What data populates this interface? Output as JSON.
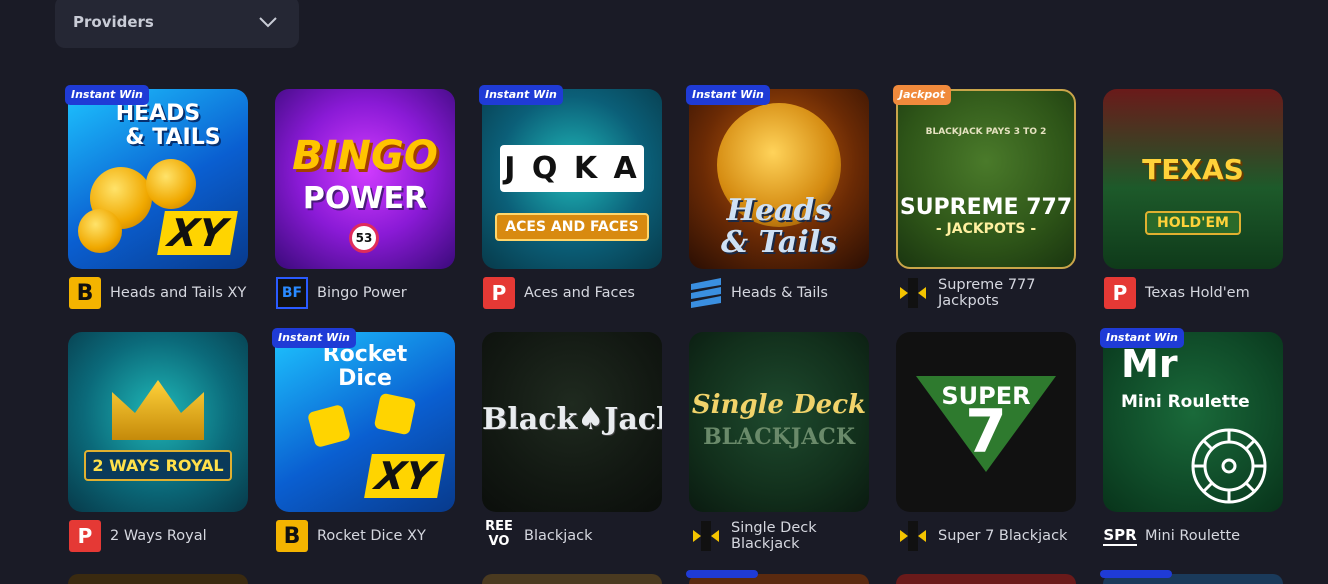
{
  "filter": {
    "label": "Providers"
  },
  "colors": {
    "background": "#1a1b26",
    "panel": "#252734",
    "instant_badge": "#1f3bd6",
    "jackpot_badge": "#f08a3c"
  },
  "games": [
    {
      "name": "Heads and Tails XY",
      "badge": "Instant Win",
      "provider_icon": "b-logo-icon",
      "art": {
        "line1": "HEADS",
        "line2": "& TAILS",
        "tag": "XY"
      }
    },
    {
      "name": "Bingo Power",
      "badge": "",
      "provider_icon": "bf-logo-icon",
      "art": {
        "line1": "BINGO",
        "line2": "POWER",
        "tag": "53"
      }
    },
    {
      "name": "Aces and Faces",
      "badge": "Instant Win",
      "provider_icon": "p-logo-icon",
      "art": {
        "line1": "J Q K A",
        "line2": "ACES AND FACES",
        "tag": ""
      }
    },
    {
      "name": "Heads & Tails",
      "badge": "Instant Win",
      "provider_icon": "wave-logo-icon",
      "art": {
        "line1": "Heads",
        "line2": "& Tails",
        "tag": ""
      }
    },
    {
      "name": "Supreme 777 Jackpots",
      "badge": "Jackpot",
      "provider_icon": "bb-logo-icon",
      "art": {
        "line1": "BLACKJACK PAYS 3 TO 2",
        "line2": "SUPREME 777",
        "tag": "- JACKPOTS -"
      }
    },
    {
      "name": "Texas Hold'em",
      "badge": "",
      "provider_icon": "p-logo-icon",
      "art": {
        "line1": "TEXAS",
        "line2": "HOLD'EM",
        "tag": ""
      }
    },
    {
      "name": "2 Ways Royal",
      "badge": "",
      "provider_icon": "p-logo-icon",
      "art": {
        "line1": "2 WAYS ROYAL",
        "line2": "",
        "tag": ""
      }
    },
    {
      "name": "Rocket Dice XY",
      "badge": "Instant Win",
      "provider_icon": "b-logo-icon",
      "art": {
        "line1": "Rocket",
        "line2": "Dice",
        "tag": "XY"
      }
    },
    {
      "name": "Blackjack",
      "badge": "",
      "provider_icon": "reevo-logo-icon",
      "art": {
        "line1": "Black♠Jack",
        "line2": "",
        "tag": ""
      }
    },
    {
      "name": "Single Deck Blackjack",
      "badge": "",
      "provider_icon": "bb-logo-icon",
      "art": {
        "line1": "Single Deck",
        "line2": "BLACKJACK",
        "tag": ""
      }
    },
    {
      "name": "Super 7 Blackjack",
      "badge": "",
      "provider_icon": "bb-logo-icon",
      "art": {
        "line1": "SUPER",
        "line2": "7",
        "tag": ""
      }
    },
    {
      "name": "Mini Roulette",
      "badge": "Instant Win",
      "provider_icon": "spr-logo-icon",
      "art": {
        "line1": "Mr",
        "line2": "Mini Roulette",
        "tag": ""
      }
    }
  ],
  "provider_logos": {
    "b": "B",
    "p": "P",
    "reevo_top": "REE",
    "reevo_bottom": "VO",
    "spr": "SPR",
    "bf": "BF"
  }
}
